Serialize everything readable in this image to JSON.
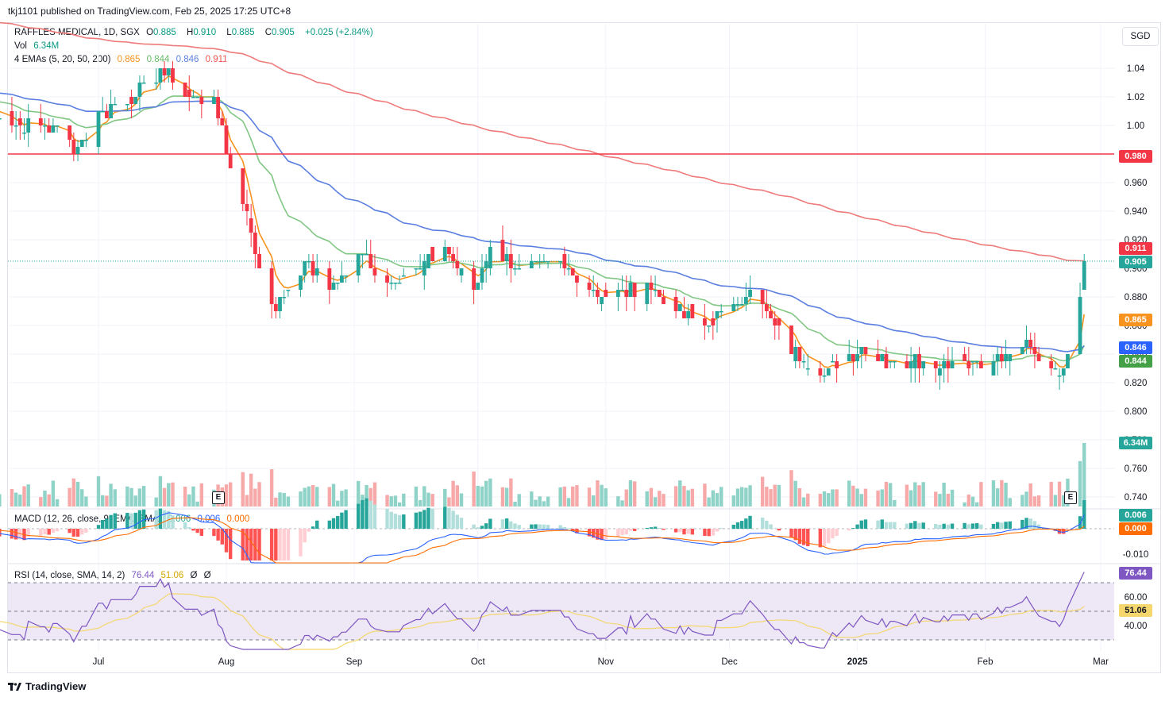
{
  "header": {
    "publish_line": "tkj1101 published on TradingView.com, Feb 25, 2025 17:25 UTC+8",
    "currency_button": "SGD"
  },
  "legend": {
    "symbol": "RAFFLES MEDICAL, 1D, SGX",
    "open_label": "O",
    "open": "0.885",
    "high_label": "H",
    "high": "0.910",
    "low_label": "L",
    "low": "0.885",
    "close_label": "C",
    "close": "0.905",
    "change": "+0.025 (+2.84%)",
    "vol_label": "Vol",
    "vol": "6.34M",
    "ema_label": "4 EMAs (5, 20, 50, 200)",
    "ema_values": [
      "0.865",
      "0.844",
      "0.846",
      "0.911"
    ],
    "ema_colors": [
      "#f7931e",
      "#81c784",
      "#5b7fe0",
      "#ef7a7a"
    ],
    "macd_label": "MACD (12, 26, close, 9, EMA, EMA)",
    "macd_values": [
      "0.006",
      "0.006",
      "0.000"
    ],
    "macd_colors": [
      "#26a69a",
      "#2962ff",
      "#ff6d00"
    ],
    "rsi_label": "RSI (14, close, SMA, 14, 2)",
    "rsi_values": [
      "76.44",
      "51.06",
      "Ø",
      "Ø"
    ],
    "rsi_colors": [
      "#7e57c2",
      "#e6c200",
      "#131722",
      "#131722"
    ]
  },
  "badges": {
    "resistance": "0.980",
    "ema200": "0.911",
    "last": "0.905",
    "ema5": "0.865",
    "ema50": "0.846",
    "ema20": "0.844",
    "volume": "6.34M",
    "macd_line": "0.006",
    "macd_signal": "0.000",
    "rsi": "76.44",
    "rsi_ma": "51.06"
  },
  "colors": {
    "up": "#26a69a",
    "down": "#f23645",
    "vol_up": "#8fd3c8",
    "vol_down": "#f7a9a9",
    "resistance": "#f23645",
    "rsi_band": "#ede7f6",
    "rsi_line": "#7e57c2",
    "rsi_ma": "#f5d76e"
  },
  "events": {
    "earnings_marker": "E"
  },
  "footer": {
    "brand": "TradingView"
  },
  "chart_data": {
    "type": "candlestick",
    "symbol": "RAFFLES MEDICAL",
    "interval": "1D",
    "exchange": "SGX",
    "price_axis": {
      "ticks": [
        "1.04",
        "1.02",
        "1.00",
        "0.980",
        "0.960",
        "0.940",
        "0.920",
        "0.900",
        "0.880",
        "0.860",
        "0.840",
        "0.820",
        "0.800",
        "0.780",
        "0.760",
        "0.740"
      ],
      "ylim": [
        0.735,
        1.07
      ]
    },
    "macd_axis": {
      "ticks": [
        "-0.010"
      ]
    },
    "rsi_axis": {
      "ticks": [
        "60.00",
        "40.00"
      ],
      "bands": [
        30,
        70
      ],
      "mid": 50
    },
    "time_axis": {
      "labels": [
        "Jul",
        "Aug",
        "Sep",
        "Oct",
        "Nov",
        "Dec",
        "2025",
        "Feb",
        "Mar"
      ]
    },
    "horizontal_line": 0.98,
    "anchors": [
      {
        "d": "2024-06-03",
        "c": 1.02
      },
      {
        "d": "2024-06-10",
        "c": 1.0
      },
      {
        "d": "2024-06-20",
        "c": 1.0
      },
      {
        "d": "2024-06-26",
        "c": 0.985
      },
      {
        "d": "2024-07-02",
        "c": 1.01
      },
      {
        "d": "2024-07-10",
        "c": 1.02
      },
      {
        "d": "2024-07-16",
        "c": 1.04
      },
      {
        "d": "2024-07-23",
        "c": 1.02
      },
      {
        "d": "2024-07-29",
        "c": 1.02
      },
      {
        "d": "2024-08-01",
        "c": 0.98
      },
      {
        "d": "2024-08-06",
        "c": 0.94
      },
      {
        "d": "2024-08-09",
        "c": 0.9
      },
      {
        "d": "2024-08-13",
        "c": 0.87
      },
      {
        "d": "2024-08-20",
        "c": 0.905
      },
      {
        "d": "2024-08-26",
        "c": 0.885
      },
      {
        "d": "2024-09-03",
        "c": 0.91
      },
      {
        "d": "2024-09-09",
        "c": 0.89
      },
      {
        "d": "2024-09-17",
        "c": 0.9
      },
      {
        "d": "2024-09-23",
        "c": 0.915
      },
      {
        "d": "2024-09-30",
        "c": 0.885
      },
      {
        "d": "2024-10-04",
        "c": 0.915
      },
      {
        "d": "2024-10-11",
        "c": 0.9
      },
      {
        "d": "2024-10-22",
        "c": 0.9
      },
      {
        "d": "2024-11-01",
        "c": 0.88
      },
      {
        "d": "2024-11-11",
        "c": 0.89
      },
      {
        "d": "2024-11-18",
        "c": 0.87
      },
      {
        "d": "2024-11-26",
        "c": 0.86
      },
      {
        "d": "2024-12-02",
        "c": 0.875
      },
      {
        "d": "2024-12-06",
        "c": 0.885
      },
      {
        "d": "2024-12-12",
        "c": 0.86
      },
      {
        "d": "2024-12-19",
        "c": 0.835
      },
      {
        "d": "2024-12-27",
        "c": 0.83
      },
      {
        "d": "2025-01-02",
        "c": 0.845
      },
      {
        "d": "2025-01-10",
        "c": 0.835
      },
      {
        "d": "2025-01-17",
        "c": 0.835
      },
      {
        "d": "2025-01-24",
        "c": 0.835
      },
      {
        "d": "2025-02-03",
        "c": 0.835
      },
      {
        "d": "2025-02-10",
        "c": 0.845
      },
      {
        "d": "2025-02-17",
        "c": 0.83
      },
      {
        "d": "2025-02-20",
        "c": 0.83
      },
      {
        "d": "2025-02-21",
        "c": 0.84
      },
      {
        "d": "2025-02-24",
        "c": 0.88
      },
      {
        "d": "2025-02-25",
        "o": 0.885,
        "h": 0.91,
        "l": 0.885,
        "c": 0.905,
        "v": 6340000
      }
    ],
    "ema_lines": [
      {
        "name": "EMA 5",
        "color": "#f7931e",
        "last": 0.865
      },
      {
        "name": "EMA 20",
        "color": "#81c784",
        "last": 0.844
      },
      {
        "name": "EMA 50",
        "color": "#5b7fe0",
        "last": 0.846
      },
      {
        "name": "EMA 200",
        "color": "#ef7a7a",
        "last": 0.911
      }
    ]
  }
}
